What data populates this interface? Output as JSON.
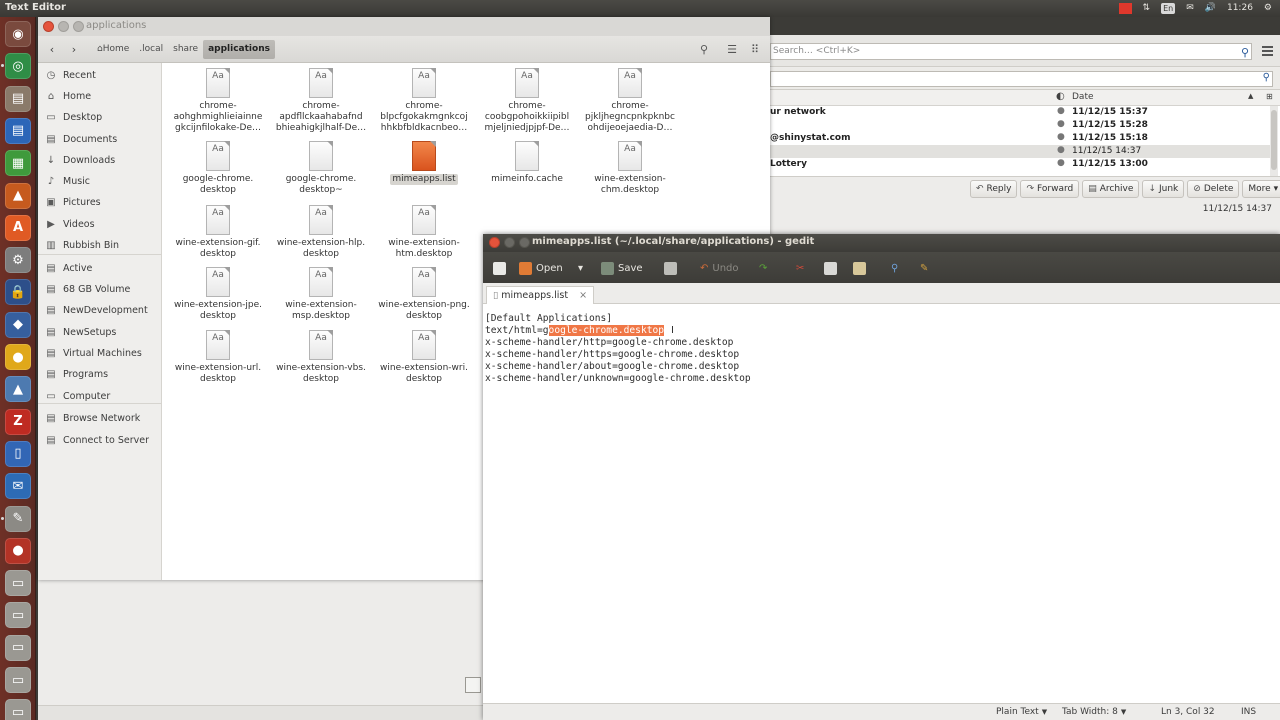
{
  "top_panel": {
    "app_title": "Text Editor",
    "keyboard": "En",
    "clock": "11:26"
  },
  "thunderbird": {
    "search_placeholder": "Search… <Ctrl+K>",
    "column_date": "Date",
    "rows": [
      {
        "from": "ur network",
        "date": "11/12/15 15:37"
      },
      {
        "from": "",
        "date": "11/12/15 15:28"
      },
      {
        "from": "@shinystat.com",
        "date": "11/12/15 15:18"
      },
      {
        "from": "",
        "date": "11/12/15 14:37"
      },
      {
        "from": "Lottery",
        "date": "11/12/15 13:00"
      }
    ],
    "actions": {
      "reply": "Reply",
      "forward": "Forward",
      "archive": "Archive",
      "junk": "Junk",
      "delete": "Delete",
      "more": "More"
    },
    "message_date": "11/12/15 14:37"
  },
  "file_manager": {
    "window_title": "applications",
    "breadcrumb": [
      "Home",
      ".local",
      "share",
      "applications"
    ],
    "sidebar": [
      {
        "label": "Recent",
        "icon": "clock-icon"
      },
      {
        "label": "Home",
        "icon": "home-icon"
      },
      {
        "label": "Desktop",
        "icon": "desktop-icon"
      },
      {
        "label": "Documents",
        "icon": "documents-icon"
      },
      {
        "label": "Downloads",
        "icon": "downloads-icon"
      },
      {
        "label": "Music",
        "icon": "music-icon"
      },
      {
        "label": "Pictures",
        "icon": "pictures-icon"
      },
      {
        "label": "Videos",
        "icon": "videos-icon"
      },
      {
        "label": "Rubbish Bin",
        "icon": "trash-icon"
      },
      {
        "label": "Active",
        "icon": "drive-icon"
      },
      {
        "label": "68 GB Volume",
        "icon": "drive-icon"
      },
      {
        "label": "NewDevelopment",
        "icon": "drive-icon"
      },
      {
        "label": "NewSetups",
        "icon": "drive-icon"
      },
      {
        "label": "Virtual Machines",
        "icon": "drive-icon"
      },
      {
        "label": "Programs",
        "icon": "drive-icon"
      },
      {
        "label": "Computer",
        "icon": "computer-icon"
      },
      {
        "label": "Browse Network",
        "icon": "network-icon"
      },
      {
        "label": "Connect to Server",
        "icon": "server-icon"
      }
    ],
    "files": [
      [
        "chrome-",
        "aohghmighlieiainne",
        "gkcijnfilokake-De…"
      ],
      [
        "chrome-",
        "apdfllckaahabafnd",
        "bhieahigkjlhalf-De…"
      ],
      [
        "chrome-",
        "blpcfgokakmgnkcoj",
        "hhkbfbldkacnbeo…"
      ],
      [
        "chrome-",
        "coobgpohoikkiipibl",
        "mjeljniedjpjpf-De…"
      ],
      [
        "chrome-",
        "pjkljhegncpnkpknbc",
        "ohdijeoejaedia-D…"
      ],
      [
        "google-chrome.",
        "desktop"
      ],
      [
        "google-chrome.",
        "desktop~"
      ],
      [
        "mimeapps.list"
      ],
      [
        "mimeinfo.cache"
      ],
      [
        "wine-extension-",
        "chm.desktop"
      ],
      [
        "wine-extension-gif.",
        "desktop"
      ],
      [
        "wine-extension-hlp.",
        "desktop"
      ],
      [
        "wine-extension-",
        "htm.desktop"
      ],
      [
        "wine-extension-jpe.",
        "desktop"
      ],
      [
        "wine-extension-",
        "msp.desktop"
      ],
      [
        "wine-extension-png.",
        "desktop"
      ],
      [
        "wine-extension-url.",
        "desktop"
      ],
      [
        "wine-extension-vbs.",
        "desktop"
      ],
      [
        "wine-extension-wri.",
        "desktop"
      ]
    ],
    "file_icon_label": "Aa"
  },
  "gedit": {
    "window_title": "mimeapps.list (~/.local/share/applications) - gedit",
    "toolbar": {
      "open": "Open",
      "save": "Save",
      "undo": "Undo"
    },
    "tab_label": "mimeapps.list",
    "lines": [
      "[Default Applications]",
      "text/html=g",
      "x-scheme-handler/http=google-chrome.desktop",
      "x-scheme-handler/https=google-chrome.desktop",
      "x-scheme-handler/about=google-chrome.desktop",
      "x-scheme-handler/unknown=google-chrome.desktop"
    ],
    "selected_text": "oogle-chrome.desktop",
    "status": {
      "language": "Plain Text",
      "tab_width": "Tab Width: 8",
      "position": "Ln 3, Col 32",
      "mode": "INS"
    }
  },
  "launcher": [
    {
      "icon": "dash-icon",
      "color": "#7a4a3e"
    },
    {
      "icon": "chrome-icon",
      "color": "#2f8d46"
    },
    {
      "icon": "files-icon",
      "color": "#8a7a6a"
    },
    {
      "icon": "writer-icon",
      "color": "#2c66b8"
    },
    {
      "icon": "calc-icon",
      "color": "#3f9a3c"
    },
    {
      "icon": "impress-icon",
      "color": "#c65a1e"
    },
    {
      "icon": "software-center-icon",
      "color": "#e05a24"
    },
    {
      "icon": "settings-icon",
      "color": "#7d7d7d"
    },
    {
      "icon": "lock-icon",
      "color": "#2d4f8a"
    },
    {
      "icon": "shield-icon",
      "color": "#365f9e"
    },
    {
      "icon": "ftp-icon",
      "color": "#e0a81a"
    },
    {
      "icon": "vlc-icon",
      "color": "#4d7ab0"
    },
    {
      "icon": "filezilla-icon",
      "color": "#bf2b22"
    },
    {
      "icon": "terminal-icon",
      "color": "#3266b5"
    },
    {
      "icon": "thunderbird-icon",
      "color": "#2d6bb5"
    },
    {
      "icon": "gedit-icon",
      "color": "#8c8a85"
    },
    {
      "icon": "unknown-app-icon",
      "color": "#b33326"
    },
    {
      "icon": "drive-icon",
      "color": "#9a9892"
    },
    {
      "icon": "drive-icon",
      "color": "#9a9892"
    },
    {
      "icon": "drive-icon",
      "color": "#9a9892"
    },
    {
      "icon": "drive-icon",
      "color": "#9a9892"
    },
    {
      "icon": "drive-icon",
      "color": "#9a9892"
    }
  ]
}
